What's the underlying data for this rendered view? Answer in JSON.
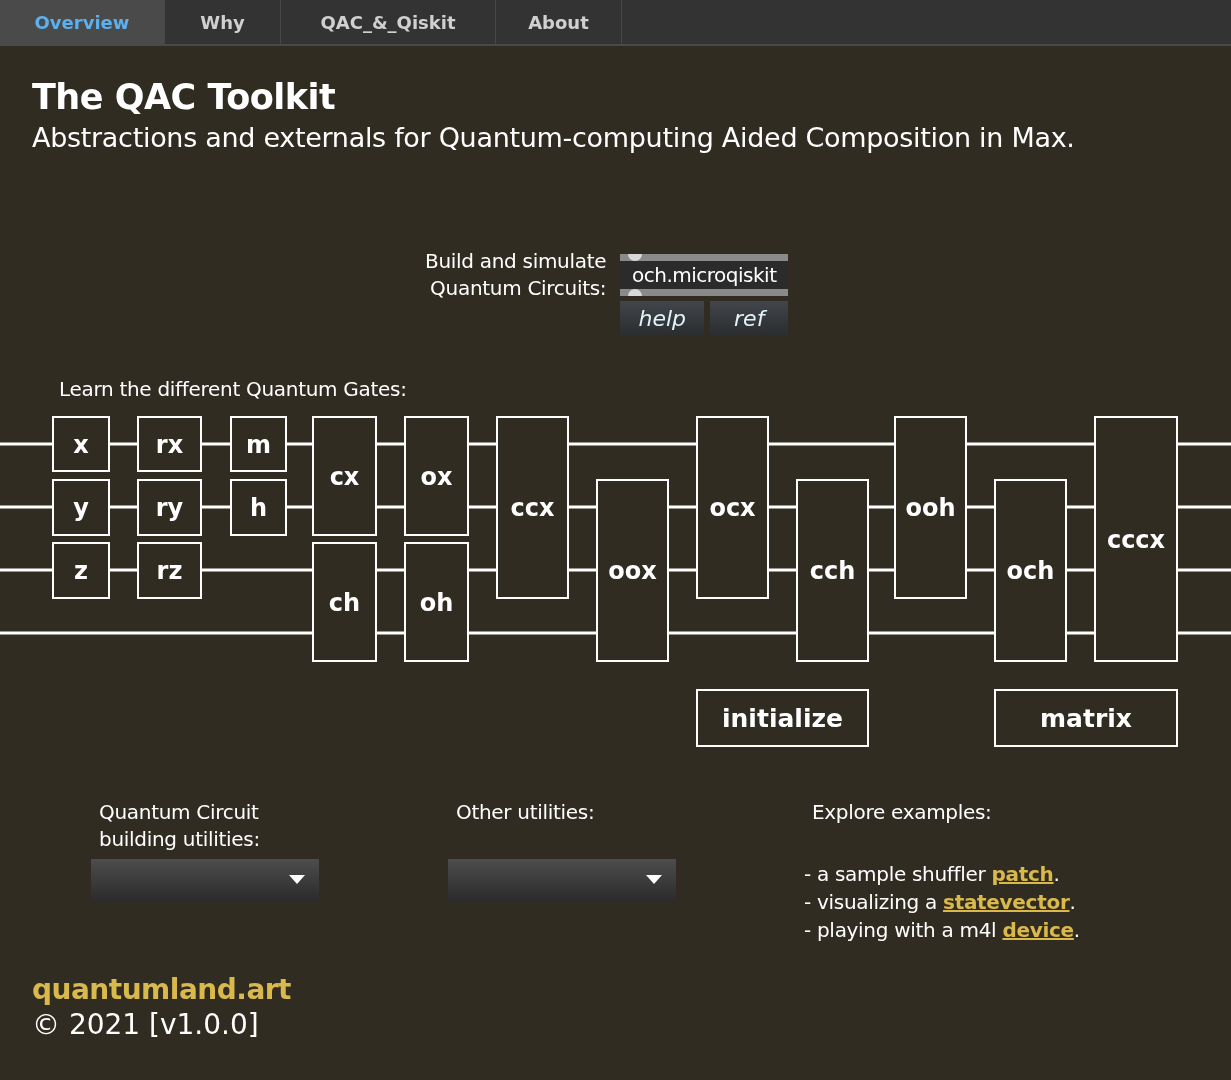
{
  "tabs": [
    {
      "label": "Overview",
      "selected": true
    },
    {
      "label": "Why",
      "selected": false
    },
    {
      "label": "QAC_&_Qiskit",
      "selected": false
    },
    {
      "label": "About",
      "selected": false
    }
  ],
  "title": "The QAC Toolkit",
  "subtitle": "Abstractions and externals for Quantum-computing Aided Composition in Max.",
  "builder": {
    "label": "Build and simulate\nQuantum Circuits:",
    "object": "och.microqiskit",
    "buttons": [
      "help",
      "ref"
    ]
  },
  "gates_heading": "Learn the different Quantum Gates:",
  "gates": [
    "x",
    "y",
    "z",
    "rx",
    "ry",
    "rz",
    "m",
    "h",
    "cx",
    "ch",
    "ox",
    "oh",
    "ccx",
    "oox",
    "ocx",
    "cch",
    "ooh",
    "och",
    "cccx"
  ],
  "gate_buttons": [
    "initialize",
    "matrix"
  ],
  "utilities": [
    {
      "label": "Quantum Circuit\nbuilding utilities:"
    },
    {
      "label": "Other utilities:"
    }
  ],
  "examples": {
    "heading": "Explore examples:",
    "items": [
      {
        "text": "- a sample shuffler ",
        "link": "patch",
        "after": "."
      },
      {
        "text": "- visualizing a ",
        "link": "statevector",
        "after": "."
      },
      {
        "text": "- playing with a m4l ",
        "link": "device",
        "after": "."
      }
    ]
  },
  "footer": {
    "link": "quantumland.art",
    "copyright": "© 2021 [v1.0.0]"
  }
}
